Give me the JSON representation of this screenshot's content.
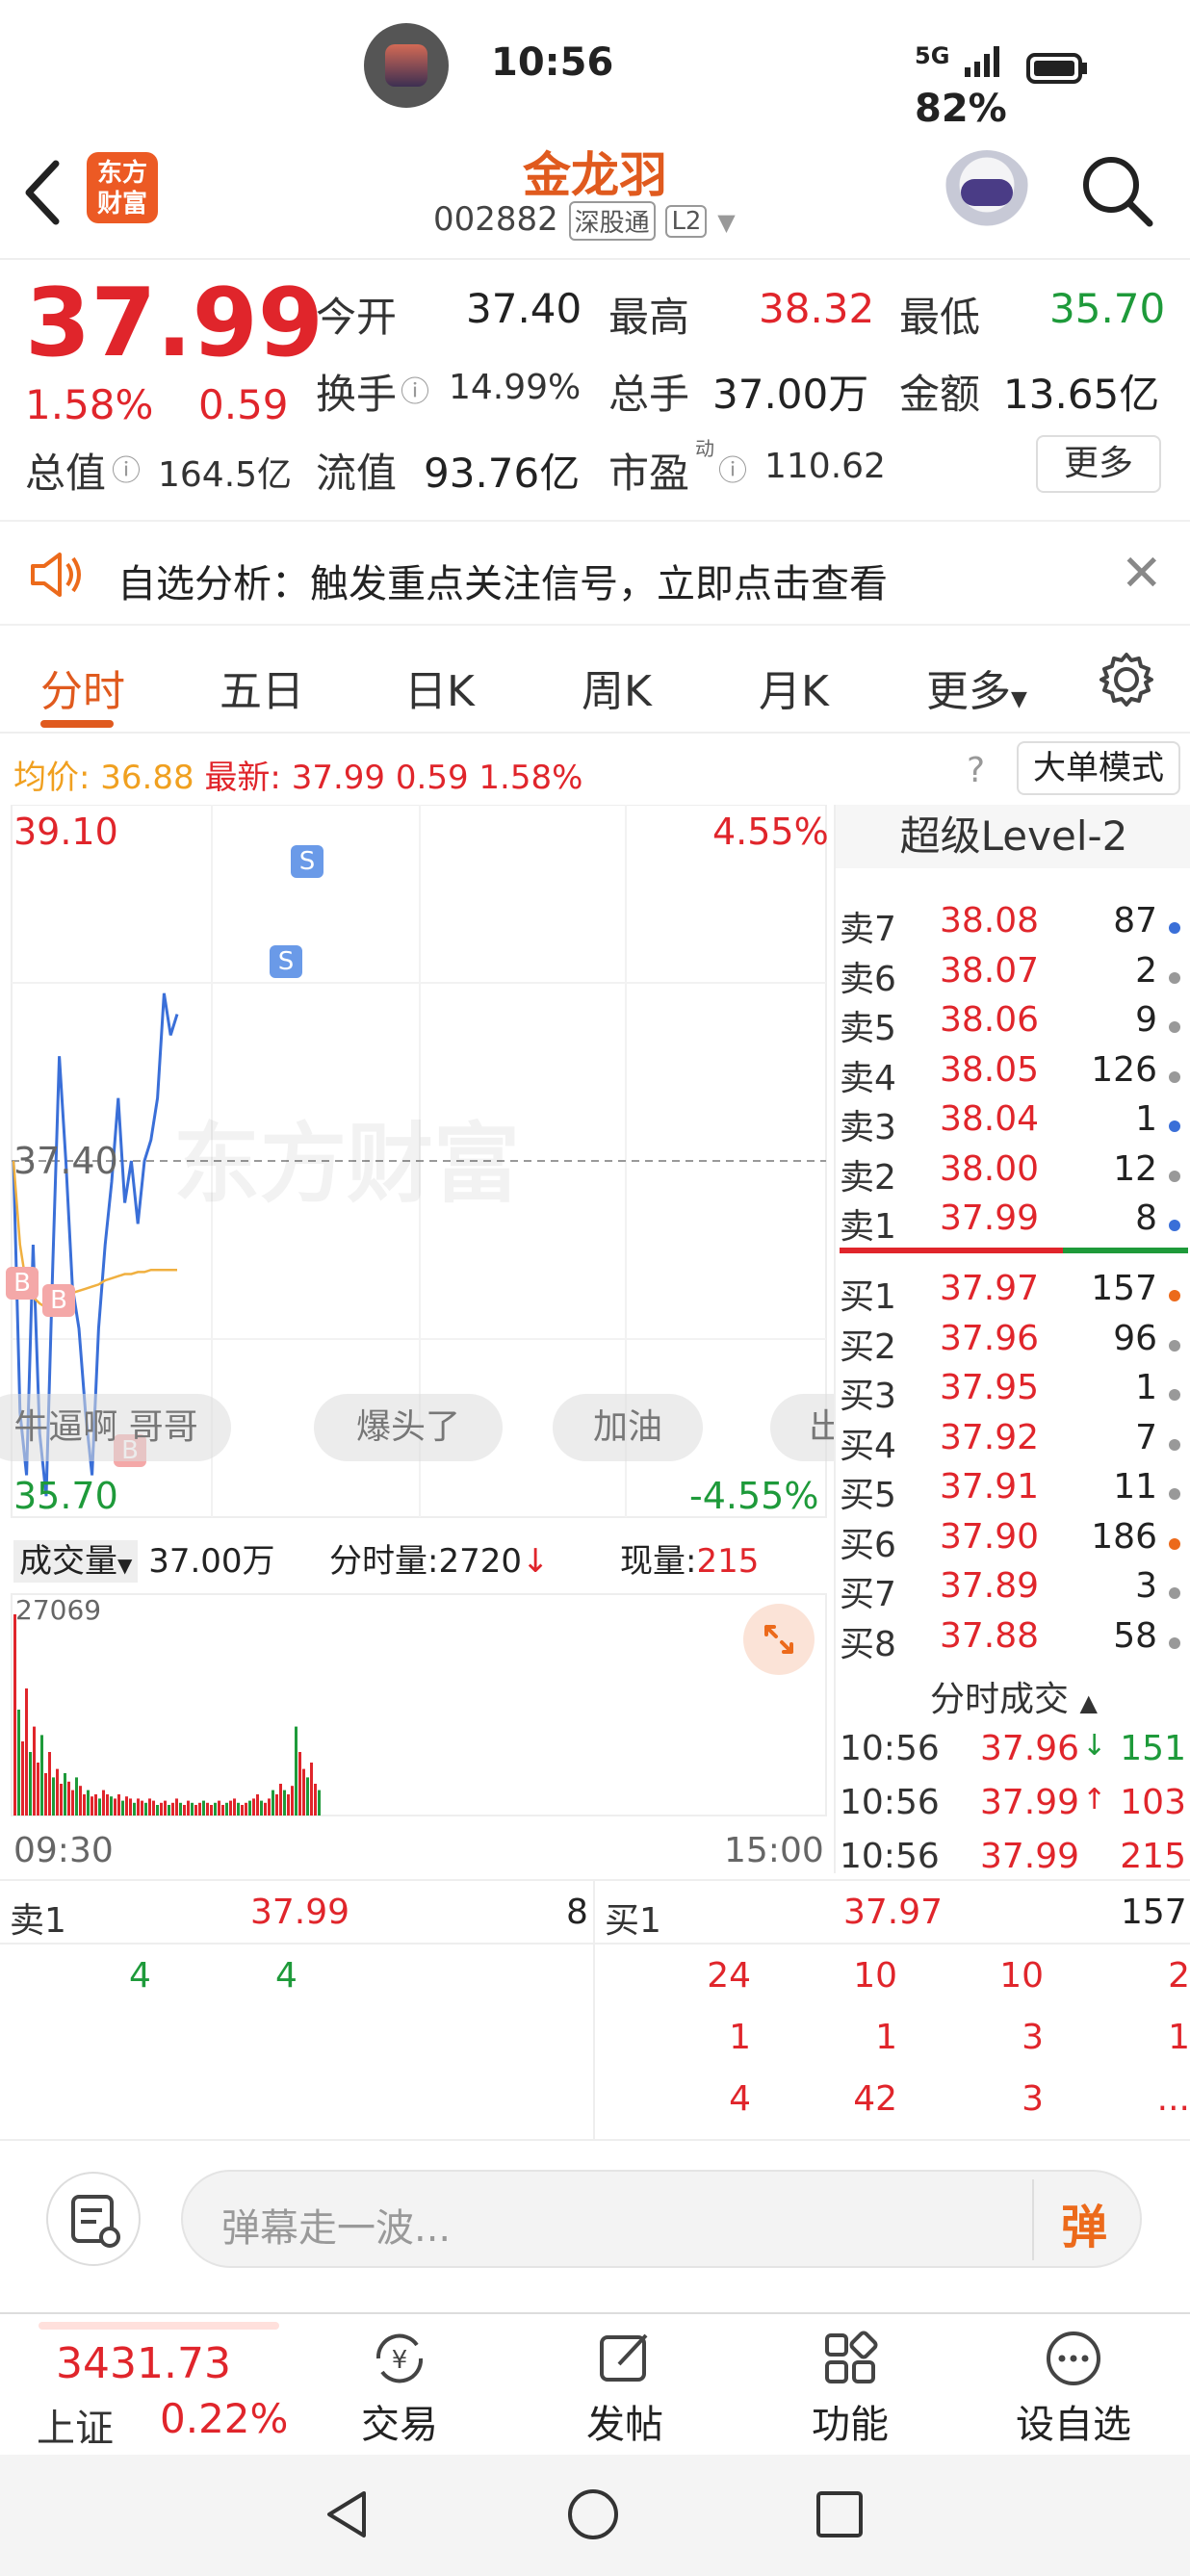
{
  "status": {
    "time": "10:56",
    "network": "5G",
    "battery": "82%"
  },
  "header": {
    "logo_line1": "东方",
    "logo_line2": "财富",
    "stock_name": "金龙羽",
    "stock_code": "002882",
    "tag1": "深股通",
    "tag2": "L2"
  },
  "quote": {
    "price": "37.99",
    "change_pct": "1.58%",
    "change_val": "0.59",
    "open_label": "今开",
    "open": "37.40",
    "high_label": "最高",
    "high": "38.32",
    "low_label": "最低",
    "low": "35.70",
    "turnover_label": "换手",
    "turnover": "14.99%",
    "volume_label": "总手",
    "volume": "37.00万",
    "amount_label": "金额",
    "amount": "13.65亿",
    "mktcap_label": "总值",
    "mktcap": "164.5亿",
    "float_label": "流值",
    "float": "93.76亿",
    "pe_label": "市盈",
    "pe_sup": "动",
    "pe": "110.62",
    "more": "更多"
  },
  "alert": {
    "text": "自选分析：触发重点关注信号，立即点击查看"
  },
  "tabs": [
    "分时",
    "五日",
    "日K",
    "周K",
    "月K",
    "更多"
  ],
  "chart_info": {
    "avg_label": "均价:",
    "avg": "36.88",
    "latest_label": "最新:",
    "latest": "37.99",
    "chg": "0.59",
    "pct": "1.58%",
    "bigorder": "大单模式"
  },
  "chart": {
    "top_price": "39.10",
    "top_pct": "4.55%",
    "mid_price": "37.40",
    "bottom_price": "35.70",
    "bottom_pct": "-4.55%",
    "watermark": "东方财富",
    "danmu": [
      "牛逼啊 哥哥",
      "爆头了",
      "加油",
      "出"
    ],
    "vol_label": "成交量",
    "vol_value": "37.00万",
    "tick_label": "分时量:2720",
    "arrow_down": "↓",
    "now_label": "现量:",
    "now_value": "215",
    "vol_max": "27069",
    "time_start": "09:30",
    "time_end": "15:00"
  },
  "chart_data": {
    "type": "line",
    "title": "",
    "ylim": [
      35.7,
      39.1
    ],
    "reference": 37.4,
    "series": [
      {
        "name": "price",
        "values": [
          37.4,
          36.2,
          35.9,
          37.0,
          36.1,
          35.8,
          36.9,
          37.9,
          37.4,
          36.8,
          36.6,
          36.2,
          35.9,
          36.6,
          37.0,
          37.3,
          37.7,
          37.2,
          37.4,
          37.1,
          37.4,
          37.5,
          37.7,
          38.2,
          38.0,
          38.1
        ]
      },
      {
        "name": "avg",
        "values": [
          37.4,
          37.0,
          36.8,
          36.75,
          36.72,
          36.7,
          36.72,
          36.74,
          36.76,
          36.77,
          36.78,
          36.79,
          36.8,
          36.81,
          36.83,
          36.84,
          36.85,
          36.86,
          36.86,
          36.87,
          36.87,
          36.88,
          36.88,
          36.88,
          36.88,
          36.88
        ]
      }
    ]
  },
  "orderbook": {
    "title": "超级Level-2",
    "sell": [
      {
        "label": "卖7",
        "price": "38.08",
        "vol": "87",
        "dot": "#3a6fd8"
      },
      {
        "label": "卖6",
        "price": "38.07",
        "vol": "2",
        "dot": "#999999"
      },
      {
        "label": "卖5",
        "price": "38.06",
        "vol": "9",
        "dot": "#999999"
      },
      {
        "label": "卖4",
        "price": "38.05",
        "vol": "126",
        "dot": "#999999"
      },
      {
        "label": "卖3",
        "price": "38.04",
        "vol": "1",
        "dot": "#3a6fd8"
      },
      {
        "label": "卖2",
        "price": "38.00",
        "vol": "12",
        "dot": "#999999"
      },
      {
        "label": "卖1",
        "price": "37.99",
        "vol": "8",
        "dot": "#3a6fd8"
      }
    ],
    "buy": [
      {
        "label": "买1",
        "price": "37.97",
        "vol": "157",
        "dot": "#ec6a1b"
      },
      {
        "label": "买2",
        "price": "37.96",
        "vol": "96",
        "dot": "#999999"
      },
      {
        "label": "买3",
        "price": "37.95",
        "vol": "1",
        "dot": "#999999"
      },
      {
        "label": "买4",
        "price": "37.92",
        "vol": "7",
        "dot": "#999999"
      },
      {
        "label": "买5",
        "price": "37.91",
        "vol": "11",
        "dot": "#999999"
      },
      {
        "label": "买6",
        "price": "37.90",
        "vol": "186",
        "dot": "#ec6a1b"
      },
      {
        "label": "买7",
        "price": "37.89",
        "vol": "3",
        "dot": "#999999"
      },
      {
        "label": "买8",
        "price": "37.88",
        "vol": "58",
        "dot": "#999999"
      }
    ],
    "trades_title": "分时成交",
    "trades": [
      {
        "time": "10:56",
        "price": "37.96",
        "arrow": "↓",
        "vol": "151"
      },
      {
        "time": "10:56",
        "price": "37.99",
        "arrow": "↑",
        "vol": "103"
      },
      {
        "time": "10:56",
        "price": "37.99",
        "arrow": "",
        "vol": "215"
      }
    ]
  },
  "level_strip": {
    "sell_label": "卖1",
    "sell_price": "37.99",
    "sell_vol": "8",
    "buy_label": "买1",
    "buy_price": "37.97",
    "buy_vol": "157",
    "sell_queue": [
      "4",
      "4"
    ],
    "buy_queue": [
      [
        "24",
        "10",
        "10",
        "2"
      ],
      [
        "1",
        "1",
        "3",
        "1"
      ],
      [
        "4",
        "42",
        "3",
        "..."
      ]
    ]
  },
  "comment": {
    "placeholder": "弹幕走一波...",
    "send": "弹"
  },
  "nav": {
    "index_value": "3431.73",
    "index_name": "上证",
    "index_pct": "0.22%",
    "items": [
      "交易",
      "发帖",
      "功能",
      "设自选"
    ]
  },
  "colors": {
    "up": "#e0252b",
    "down": "#1e9a3a",
    "brand": "#e05a1e",
    "line": "#3a6fd8",
    "avg": "#f0b040"
  }
}
